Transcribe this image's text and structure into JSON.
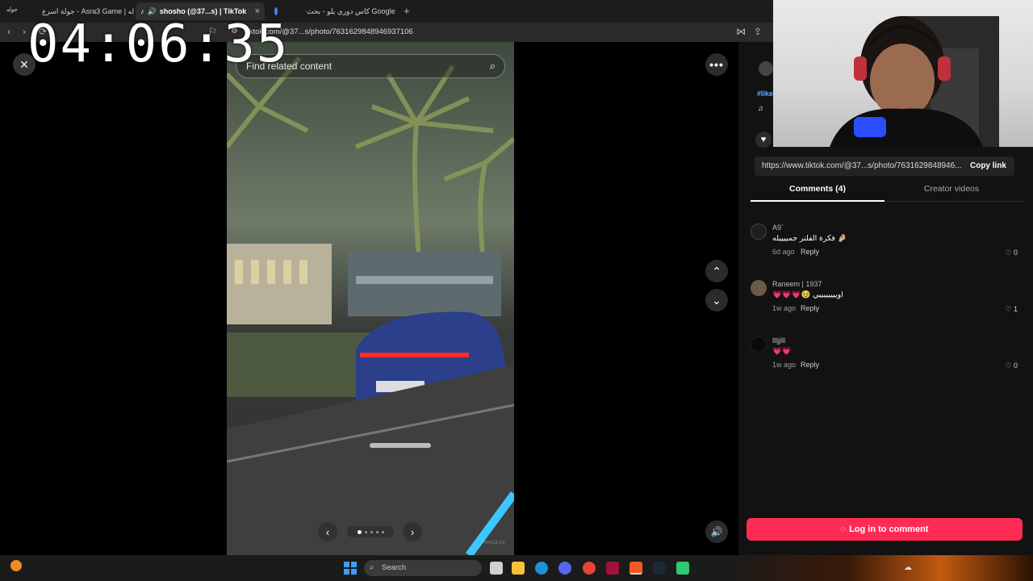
{
  "browser": {
    "tabs": [
      {
        "label": "جولة اسرع - Asra3 Game | جوله"
      },
      {
        "label": "shosho (@37...s) | TikTok"
      },
      {
        "label": "كاس دوري يلو - بحث Google"
      }
    ],
    "url": "tiktok.com/@37...s/photo/7631629848946937106"
  },
  "overlay": {
    "timer": "04:06:35"
  },
  "viewer": {
    "search_placeholder": "Find related content",
    "carousel": {
      "total": 5,
      "current": 1
    },
    "photo_watermark": "Hnn13-23"
  },
  "panel": {
    "hashtag": "#like",
    "link_url": "https://www.tiktok.com/@37...s/photo/7631629848946...",
    "copy_link": "Copy link",
    "tabs": [
      {
        "label": "Comments (4)",
        "active": true
      },
      {
        "label": "Creator videos",
        "active": false
      }
    ],
    "comments": [
      {
        "name": "A9`",
        "text": "فكرة الفلتر جمييييله 🤌🏼",
        "time": "6d ago",
        "reply": "Reply",
        "likes": "0"
      },
      {
        "name": "Raneem | 1937",
        "text": "💗💗💗🥹 اوييييييييي",
        "time": "1w ago",
        "reply": "Reply",
        "likes": "1"
      },
      {
        "name": "llljjlll",
        "text": "💗💗",
        "time": "1w ago",
        "reply": "Reply",
        "likes": "0"
      }
    ],
    "login_label": "Log in to comment"
  },
  "taskbar": {
    "search_label": "Search"
  },
  "colors": {
    "accent": "#fe2c55",
    "panel_bg": "#121212"
  }
}
